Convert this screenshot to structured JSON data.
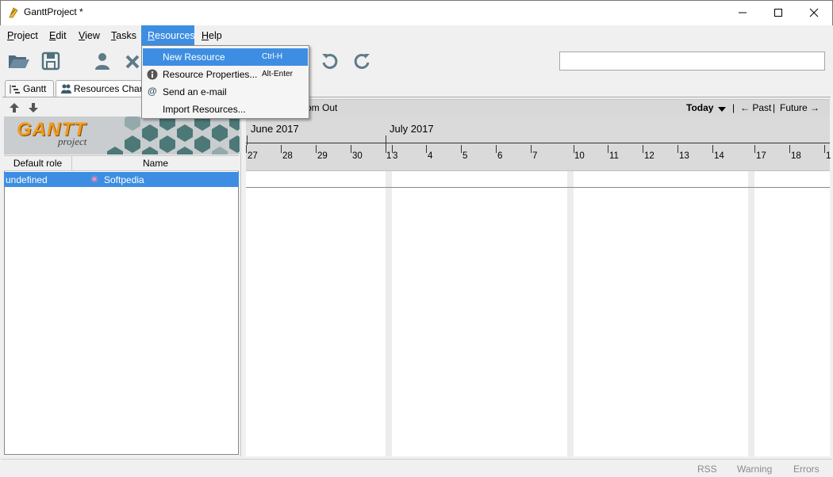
{
  "window": {
    "title": "GanttProject *",
    "minimize_glyph": "—",
    "maximize_glyph": "☐",
    "close_glyph": "✕"
  },
  "menubar": [
    {
      "label": "Project",
      "accel": "P"
    },
    {
      "label": "Edit",
      "accel": "E"
    },
    {
      "label": "View",
      "accel": "V"
    },
    {
      "label": "Tasks",
      "accel": "T"
    },
    {
      "label": "Resources",
      "accel": "R"
    },
    {
      "label": "Help",
      "accel": "H"
    }
  ],
  "resources_menu": [
    {
      "label": "New Resource",
      "shortcut": "Ctrl-H",
      "icon": "person-add-icon"
    },
    {
      "label": "Resource Properties...",
      "shortcut": "Alt-Enter",
      "icon": "info-icon"
    },
    {
      "label": "Send an e-mail",
      "shortcut": "",
      "icon": "at-sign-icon"
    },
    {
      "label": "Import Resources...",
      "shortcut": "",
      "icon": ""
    }
  ],
  "toolbar": {
    "search": {
      "value": "",
      "placeholder": ""
    }
  },
  "tabs": [
    {
      "label": "Gantt"
    },
    {
      "label": "Resources Chart"
    }
  ],
  "left_pane": {
    "logo_text": "GANTT",
    "logo_subtext": "project",
    "columns": [
      "Default role",
      "Name"
    ],
    "rows": [
      {
        "role": "undefined",
        "name": "Softpedia"
      }
    ]
  },
  "chart": {
    "zoom_out_label": "Zoom Out",
    "today_label": "Today",
    "past_label": "← Past",
    "future_label": "Future →",
    "separator": "|",
    "months": [
      "June 2017",
      "July 2017"
    ],
    "days": [
      "27",
      "28",
      "29",
      "30",
      "1",
      "3",
      "4",
      "5",
      "6",
      "7",
      "10",
      "11",
      "12",
      "13",
      "14",
      "17",
      "18",
      "1"
    ]
  },
  "statusbar": [
    "RSS",
    "Warning",
    "Errors"
  ],
  "colors": {
    "accent": "#3d8ee2",
    "logo_orange": "#f39a1e"
  }
}
